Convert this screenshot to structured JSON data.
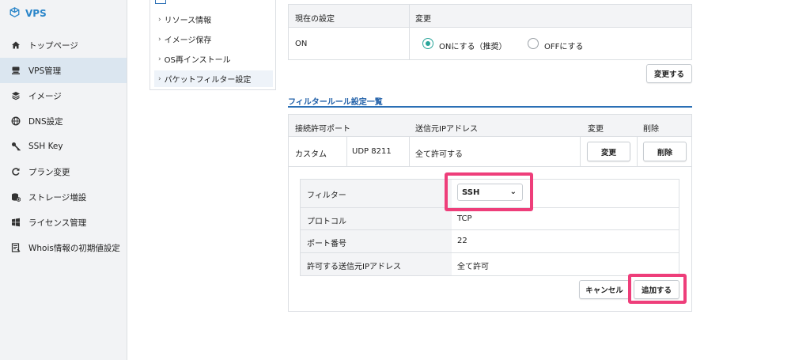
{
  "brand": {
    "name": "VPS"
  },
  "sidebar": {
    "items": [
      {
        "label": "トップページ",
        "icon": "home-icon",
        "active": false
      },
      {
        "label": "VPS管理",
        "icon": "server-icon",
        "active": true
      },
      {
        "label": "イメージ",
        "icon": "layers-icon",
        "active": false
      },
      {
        "label": "DNS設定",
        "icon": "globe-icon",
        "active": false
      },
      {
        "label": "SSH Key",
        "icon": "key-icon",
        "active": false
      },
      {
        "label": "プラン変更",
        "icon": "refresh-icon",
        "active": false
      },
      {
        "label": "ストレージ増設",
        "icon": "storage-icon",
        "active": false
      },
      {
        "label": "ライセンス管理",
        "icon": "windows-icon",
        "active": false
      },
      {
        "label": "Whois情報の初期値設定",
        "icon": "document-icon",
        "active": false
      }
    ]
  },
  "submenu": {
    "items": [
      {
        "label": "リソース情報"
      },
      {
        "label": "イメージ保存"
      },
      {
        "label": "OS再インストール"
      },
      {
        "label": "パケットフィルター設定"
      }
    ]
  },
  "current_setting": {
    "col_current": "現在の設定",
    "col_change": "変更",
    "value": "ON",
    "option_on": "ONにする（推奨）",
    "option_off": "OFFにする",
    "selected": "on",
    "change_button": "変更する"
  },
  "rules": {
    "title": "フィルタールール設定一覧",
    "headers": {
      "port": "接続許可ポート",
      "source_ip": "送信元IPアドレス",
      "edit": "変更",
      "delete": "削除"
    },
    "rows": [
      {
        "name": "カスタム",
        "port": "UDP 8211",
        "source_ip": "全て許可する",
        "edit_label": "変更",
        "delete_label": "削除"
      }
    ]
  },
  "add_form": {
    "filter_label": "フィルター",
    "filter_value": "SSH",
    "protocol_label": "プロトコル",
    "protocol_value": "TCP",
    "port_label": "ポート番号",
    "port_value": "22",
    "source_label": "許可する送信元IPアドレス",
    "source_value": "全て許可",
    "cancel_button": "キャンセル",
    "add_button": "追加する"
  },
  "colors": {
    "accent": "#2a6fb5",
    "radio_selected": "#2aa59a",
    "highlight": "#ee3e7a"
  }
}
